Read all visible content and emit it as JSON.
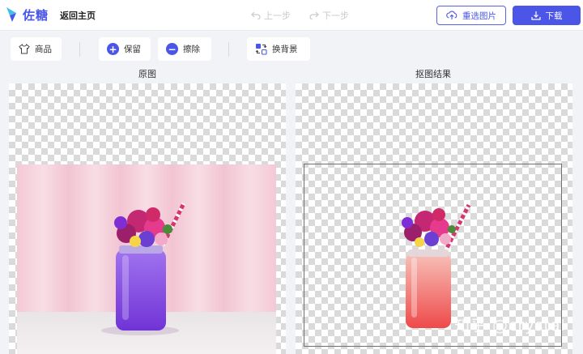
{
  "header": {
    "brand": "佐糖",
    "back_label": "返回主页",
    "undo_label": "上一步",
    "redo_label": "下一步",
    "reselect_label": "重选图片",
    "download_label": "下载"
  },
  "toolbar": {
    "goods_label": "商品",
    "keep_label": "保留",
    "erase_label": "擦除",
    "change_bg_label": "换背景"
  },
  "panels": {
    "original_label": "原图",
    "result_label": "抠图结果",
    "watermark": "知乎 @crystal"
  },
  "colors": {
    "accent": "#4b56e8",
    "checker": "#dadada"
  },
  "icons": [
    "logo-icon",
    "undo-icon",
    "redo-icon",
    "upload-icon",
    "download-icon",
    "shirt-icon",
    "plus-icon",
    "minus-icon",
    "swap-icon"
  ]
}
